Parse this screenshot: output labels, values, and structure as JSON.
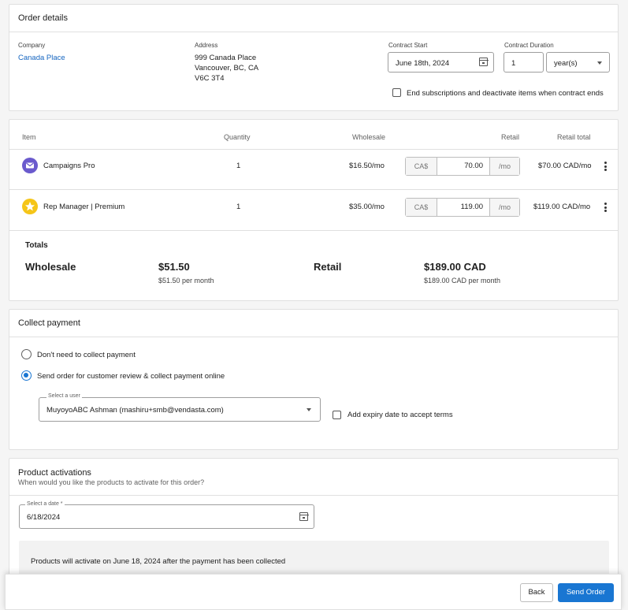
{
  "order": {
    "title": "Order details",
    "company_label": "Company",
    "company_name": "Canada Place",
    "address_label": "Address",
    "address_lines": [
      "999 Canada Place",
      "Vancouver, BC, CA",
      "V6C 3T4"
    ],
    "contract_start_label": "Contract Start",
    "contract_start_value": "June 18th, 2024",
    "contract_duration_label": "Contract Duration",
    "contract_duration_value": "1",
    "contract_duration_unit": "year(s)",
    "end_subscriptions_label": "End subscriptions and deactivate items when contract ends"
  },
  "items": {
    "headers": {
      "item": "Item",
      "quantity": "Quantity",
      "wholesale": "Wholesale",
      "retail": "Retail",
      "retail_total": "Retail total"
    },
    "rows": [
      {
        "name": "Campaigns Pro",
        "icon": "campaigns-icon",
        "icon_color": "#6a5acd",
        "quantity": "1",
        "wholesale": "$16.50/mo",
        "retail_prefix": "CA$",
        "retail_value": "70.00",
        "retail_suffix": "/mo",
        "retail_total": "$70.00 CAD/mo"
      },
      {
        "name": "Rep Manager | Premium",
        "icon": "star-icon",
        "icon_color": "#f5c518",
        "quantity": "1",
        "wholesale": "$35.00/mo",
        "retail_prefix": "CA$",
        "retail_value": "119.00",
        "retail_suffix": "/mo",
        "retail_total": "$119.00 CAD/mo"
      }
    ],
    "totals": {
      "title": "Totals",
      "wholesale_label": "Wholesale",
      "wholesale_value": "$51.50",
      "wholesale_sub": "$51.50 per month",
      "retail_label": "Retail",
      "retail_value": "$189.00 CAD",
      "retail_sub": "$189.00 CAD per month"
    }
  },
  "payment": {
    "title": "Collect payment",
    "option_none": "Don't need to collect payment",
    "option_send": "Send order for customer review & collect payment online",
    "selected_option": "send",
    "select_user_label": "Select a user",
    "select_user_value": "MuyoyoABC Ashman (mashiru+smb@vendasta.com)",
    "expiry_label": "Add expiry date to accept terms"
  },
  "activation": {
    "title": "Product activations",
    "subtitle": "When would you like the products to activate for this order?",
    "date_label": "Select a date *",
    "date_value": "6/18/2024",
    "notice": "Products will activate on June 18, 2024 after the payment has been collected"
  },
  "actions": {
    "back_label": "Back",
    "send_label": "Send Order",
    "accent_color": "#1976d2"
  }
}
